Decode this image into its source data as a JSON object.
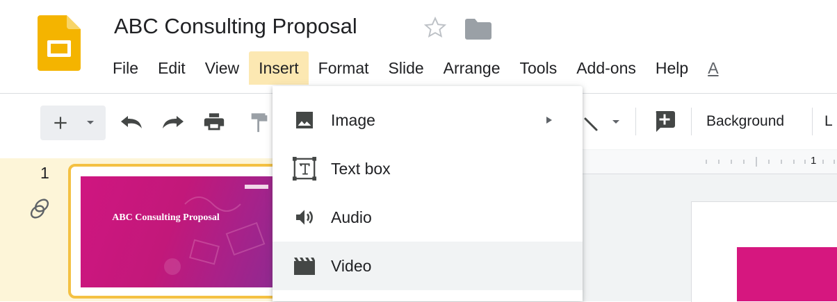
{
  "app": {
    "document_title": "ABC Consulting Proposal"
  },
  "menu": {
    "items": [
      "File",
      "Edit",
      "View",
      "Insert",
      "Format",
      "Slide",
      "Arrange",
      "Tools",
      "Add-ons",
      "Help",
      "A"
    ],
    "active": "Insert"
  },
  "toolbar": {
    "background_label": "Background",
    "layout_label": "L"
  },
  "filmstrip": {
    "slide_number": "1",
    "thumbnail_title": "ABC Consulting Proposal"
  },
  "ruler": {
    "label": "1"
  },
  "insert_menu": {
    "items": [
      {
        "label": "Image",
        "icon": "image-icon",
        "has_submenu": true
      },
      {
        "label": "Text box",
        "icon": "text-box-icon",
        "has_submenu": false
      },
      {
        "label": "Audio",
        "icon": "audio-icon",
        "has_submenu": false
      },
      {
        "label": "Video",
        "icon": "video-icon",
        "has_submenu": false,
        "highlighted": true
      }
    ]
  },
  "colors": {
    "brand_yellow": "#f4b400",
    "active_menu": "#fce8b2",
    "slide_pink": "#d6177f"
  }
}
